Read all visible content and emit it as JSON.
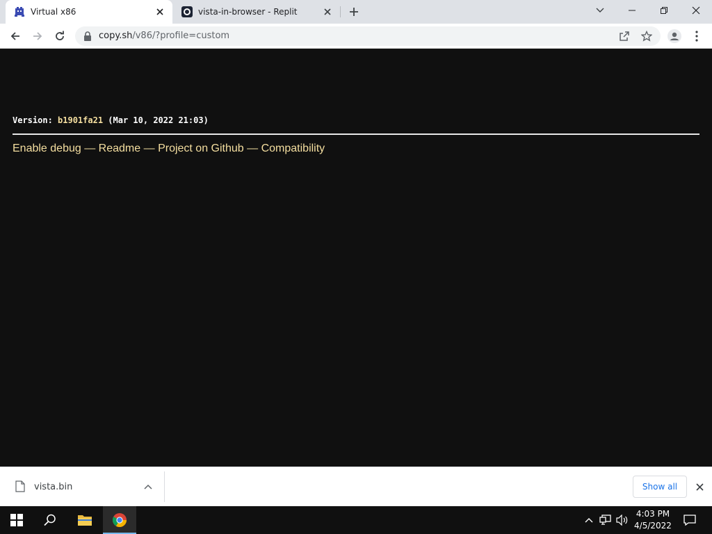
{
  "browser": {
    "tabs": [
      {
        "title": "Virtual x86",
        "active": true,
        "favicon": "v86-favicon-icon"
      },
      {
        "title": "vista-in-browser - Replit",
        "active": false,
        "favicon": "replit-favicon-icon"
      }
    ],
    "url_host": "copy.sh",
    "url_path": "/v86/?profile=custom"
  },
  "page": {
    "version_label": "Version:",
    "version_hash": "b1901fa21",
    "version_date": "(Mar 10, 2022 21:03)",
    "links": [
      "Enable debug",
      "Readme",
      "Project on Github",
      "Compatibility"
    ],
    "link_separator": "—"
  },
  "download_shelf": {
    "filename": "vista.bin",
    "show_all_label": "Show all"
  },
  "taskbar": {
    "time": "4:03 PM",
    "date": "4/5/2022"
  },
  "colors": {
    "page_bg": "#101010",
    "link_color": "#f5dfa0",
    "accent": "#1a73e8"
  }
}
